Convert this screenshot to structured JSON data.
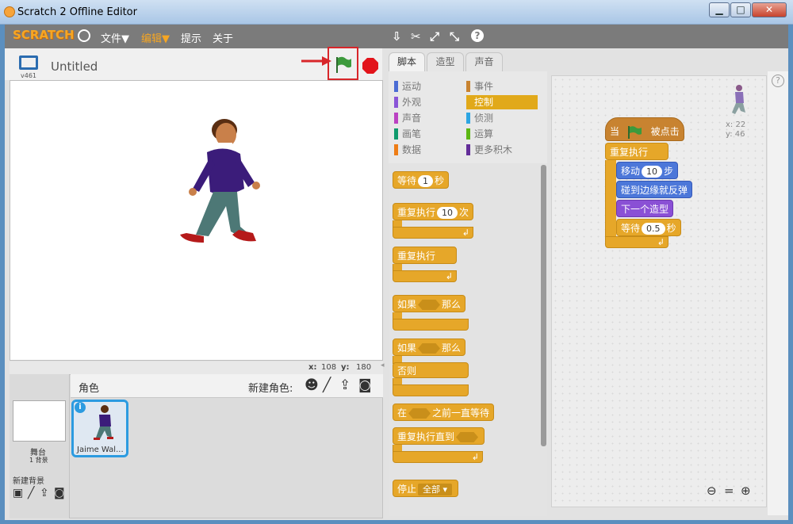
{
  "window": {
    "title": "Scratch 2 Offline Editor",
    "min": "▁",
    "max": "□",
    "close": "✕"
  },
  "menu": {
    "logo": "SCRATCH",
    "file": "文件▼",
    "edit": "编辑▼",
    "tips": "提示",
    "about": "关于"
  },
  "stage": {
    "version": "v461",
    "title": "Untitled",
    "coord_x_label": "x:",
    "coord_x": "108",
    "coord_y_label": "y:",
    "coord_y": "180"
  },
  "tabs": {
    "scripts": "脚本",
    "costumes": "造型",
    "sounds": "声音"
  },
  "categories": [
    {
      "label": "运动",
      "color": "#4a6cd4"
    },
    {
      "label": "外观",
      "color": "#8a55d7"
    },
    {
      "label": "声音",
      "color": "#bb42c3"
    },
    {
      "label": "画笔",
      "color": "#0e9a6c"
    },
    {
      "label": "数据",
      "color": "#ee7d16"
    },
    {
      "label": "事件",
      "color": "#c88330"
    },
    {
      "label": "控制",
      "color": "#e1a91a"
    },
    {
      "label": "侦测",
      "color": "#2ca5e2"
    },
    {
      "label": "运算",
      "color": "#5cb712"
    },
    {
      "label": "更多积木",
      "color": "#632d99"
    }
  ],
  "palette": {
    "wait": "等待",
    "wait_val": "1",
    "wait_unit": "秒",
    "repeat": "重复执行",
    "repeat_val": "10",
    "repeat_unit": "次",
    "forever": "重复执行",
    "if": "如果",
    "then": "那么",
    "if2": "如果",
    "then2": "那么",
    "else": "否则",
    "wait_until_pre": "在",
    "wait_until_post": "之前一直等待",
    "repeat_until": "重复执行直到",
    "stop": "停止",
    "stop_val": "全部 ▾"
  },
  "script": {
    "hat_pre": "当",
    "hat_post": "被点击",
    "forever": "重复执行",
    "move": "移动",
    "move_val": "10",
    "move_unit": "步",
    "bounce": "碰到边缘就反弹",
    "next_costume": "下一个造型",
    "wait": "等待",
    "wait_val": "0.5",
    "wait_unit": "秒",
    "sprite_x": "x: 22",
    "sprite_y": "y: 46"
  },
  "sprites": {
    "header": "角色",
    "new_sprite": "新建角色:",
    "stage_label": "舞台",
    "stage_count": "1 背景",
    "new_backdrop": "新建背景",
    "sprite_name": "Jaime Wal..."
  },
  "colors": {
    "accent": "#e6a729",
    "highlight": "#d8262a",
    "flag": "#3c9a3c"
  }
}
